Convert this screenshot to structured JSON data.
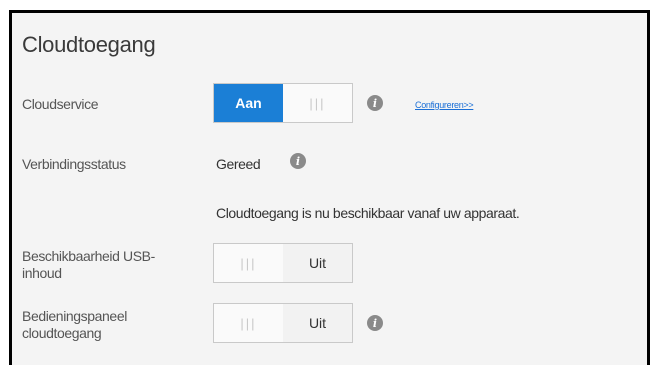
{
  "section": {
    "title": "Cloudtoegang"
  },
  "cloudservice": {
    "label": "Cloudservice",
    "toggle_on_label": "Aan",
    "toggle_grip": "|||",
    "state": "on",
    "configure_link": "Configureren>>"
  },
  "connection": {
    "label": "Verbindingsstatus",
    "status": "Gereed",
    "message": "Cloudtoegang is nu beschikbaar vanaf uw apparaat."
  },
  "usb_availability": {
    "label_line1": "Beschikbaarheid USB-",
    "label_line2": "inhoud",
    "toggle_grip": "|||",
    "toggle_off_label": "Uit",
    "state": "off"
  },
  "cloud_dashboard": {
    "label_line1": "Bedieningspaneel",
    "label_line2": "cloudtoegang",
    "toggle_grip": "|||",
    "toggle_off_label": "Uit",
    "state": "off"
  },
  "colors": {
    "accent": "#1b7fd6",
    "info_icon": "#8a8a8a"
  }
}
